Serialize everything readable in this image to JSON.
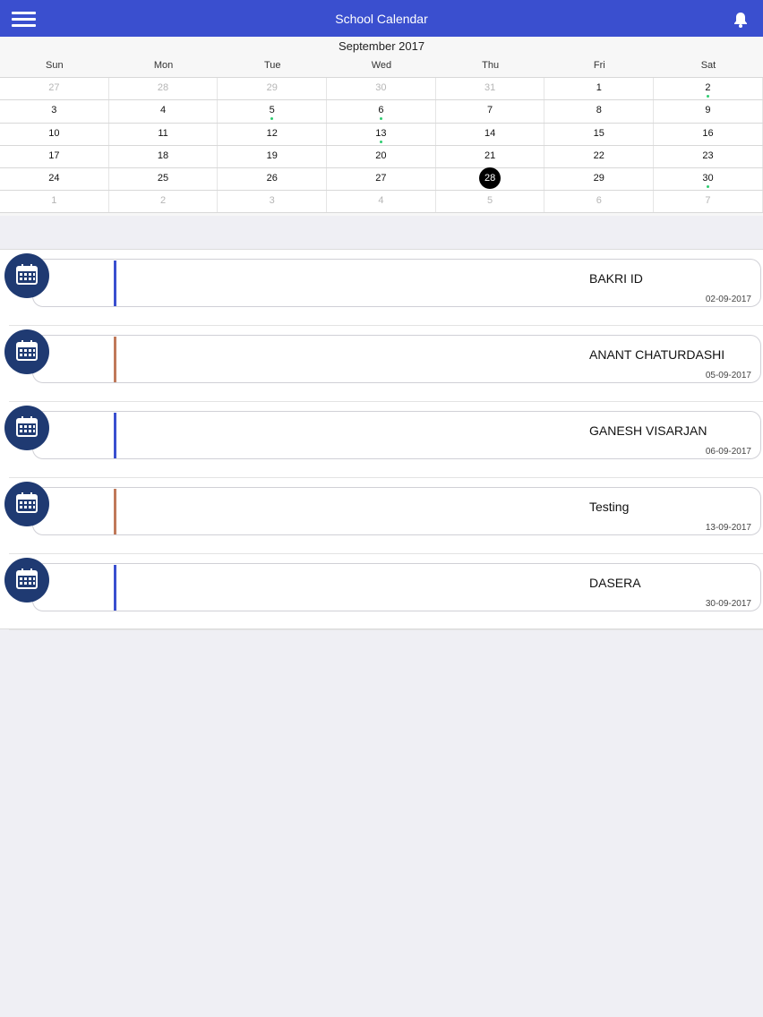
{
  "header": {
    "title": "School Calendar",
    "menu_icon": "hamburger-menu-icon",
    "bell_icon": "bell-icon"
  },
  "calendar": {
    "month": "September 2017",
    "weekdays": [
      "Sun",
      "Mon",
      "Tue",
      "Wed",
      "Thu",
      "Fri",
      "Sat"
    ],
    "weeks": [
      [
        {
          "d": "27",
          "other": true
        },
        {
          "d": "28",
          "other": true
        },
        {
          "d": "29",
          "other": true
        },
        {
          "d": "30",
          "other": true
        },
        {
          "d": "31",
          "other": true
        },
        {
          "d": "1"
        },
        {
          "d": "2",
          "dot": true
        }
      ],
      [
        {
          "d": "3"
        },
        {
          "d": "4"
        },
        {
          "d": "5",
          "dot": true
        },
        {
          "d": "6",
          "dot": true
        },
        {
          "d": "7"
        },
        {
          "d": "8"
        },
        {
          "d": "9"
        }
      ],
      [
        {
          "d": "10"
        },
        {
          "d": "11"
        },
        {
          "d": "12"
        },
        {
          "d": "13",
          "dot": true
        },
        {
          "d": "14"
        },
        {
          "d": "15"
        },
        {
          "d": "16"
        }
      ],
      [
        {
          "d": "17"
        },
        {
          "d": "18"
        },
        {
          "d": "19"
        },
        {
          "d": "20"
        },
        {
          "d": "21"
        },
        {
          "d": "22"
        },
        {
          "d": "23"
        }
      ],
      [
        {
          "d": "24"
        },
        {
          "d": "25"
        },
        {
          "d": "26"
        },
        {
          "d": "27"
        },
        {
          "d": "28",
          "today": true
        },
        {
          "d": "29"
        },
        {
          "d": "30",
          "dot": true
        }
      ],
      [
        {
          "d": "1",
          "other": true
        },
        {
          "d": "2",
          "other": true
        },
        {
          "d": "3",
          "other": true
        },
        {
          "d": "4",
          "other": true
        },
        {
          "d": "5",
          "other": true
        },
        {
          "d": "6",
          "other": true
        },
        {
          "d": "7",
          "other": true
        }
      ]
    ]
  },
  "events": [
    {
      "title": "BAKRI ID",
      "date": "02-09-2017",
      "bar_color": "#3a4fcf"
    },
    {
      "title": "ANANT CHATURDASHI",
      "date": "05-09-2017",
      "bar_color": "#c0795a"
    },
    {
      "title": "GANESH VISARJAN",
      "date": "06-09-2017",
      "bar_color": "#3a4fcf"
    },
    {
      "title": "Testing",
      "date": "13-09-2017",
      "bar_color": "#c0795a"
    },
    {
      "title": "DASERA",
      "date": "30-09-2017",
      "bar_color": "#3a4fcf"
    }
  ],
  "colors": {
    "header_bg": "#3a4fcf",
    "event_icon_bg": "#1f3a72",
    "event_dot": "#2ecc71"
  }
}
